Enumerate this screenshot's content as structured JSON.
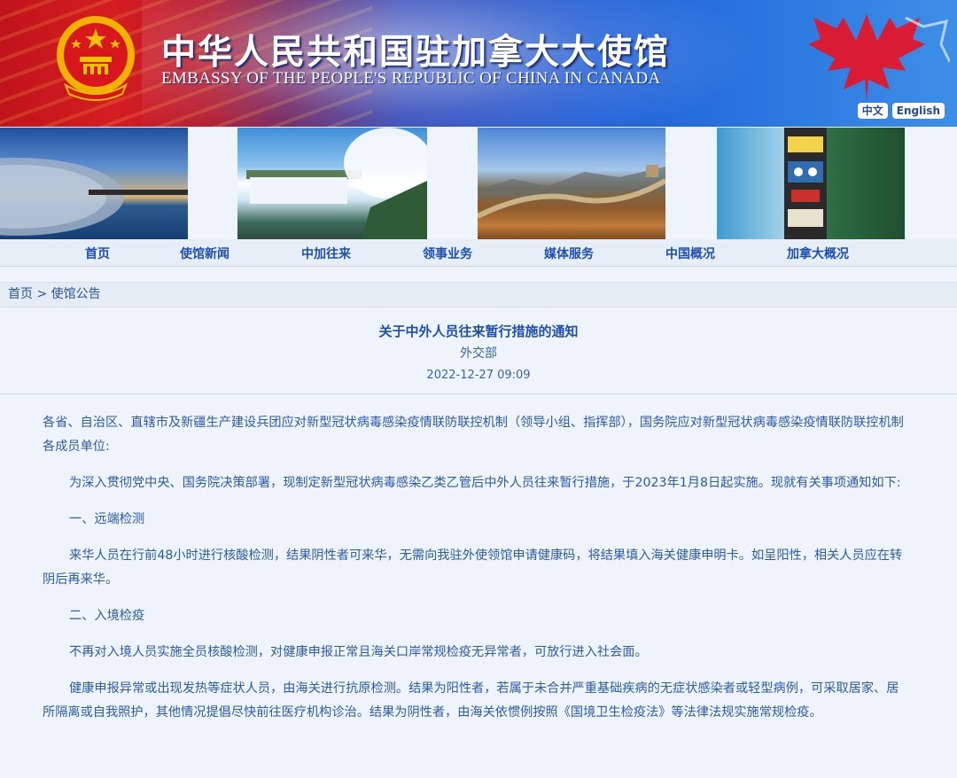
{
  "header": {
    "title_cn": "中华人民共和国驻加拿大大使馆",
    "title_en": "EMBASSY OF THE PEOPLE'S REPUBLIC OF CHINA IN CANADA",
    "lang_buttons": [
      "中文",
      "English"
    ],
    "colors": {
      "red": "#c0141a",
      "blue": "#1f5fd6",
      "gold": "#f5c200"
    }
  },
  "nav": [
    "首页",
    "使馆新闻",
    "中加往来",
    "领事业务",
    "媒体服务",
    "中国概况",
    "加拿大概况"
  ],
  "breadcrumb": {
    "home": "首页",
    "separator": ">",
    "section": "使馆公告"
  },
  "article": {
    "title": "关于中外人员往来暂行措施的通知",
    "source": "外交部",
    "date": "2022-12-27 09:09",
    "paragraphs": [
      "各省、自治区、直辖市及新疆生产建设兵团应对新型冠状病毒感染疫情联防联控机制（领导小组、指挥部），国务院应对新型冠状病毒感染疫情联防联控机制各成员单位:",
      "为深入贯彻党中央、国务院决策部署，现制定新型冠状病毒感染乙类乙管后中外人员往来暂行措施，于2023年1月8日起实施。现就有关事项通知如下:",
      "一、远端检测",
      "来华人员在行前48小时进行核酸检测，结果阴性者可来华，无需向我驻外使领馆申请健康码，将结果填入海关健康申明卡。如呈阳性，相关人员应在转阴后再来华。",
      "二、入境检疫",
      "不再对入境人员实施全员核酸检测，对健康申报正常且海关口岸常规检疫无异常者，可放行进入社会面。",
      "健康申报异常或出现发热等症状人员，由海关进行抗原检测。结果为阳性者，若属于未合并严重基础疾病的无症状感染者或轻型病例，可采取居家、居所隔离或自我照护，其他情况提倡尽快前往医疗机构诊治。结果为阴性者，由海关依惯例按照《国境卫生检疫法》等法律法规实施常规检疫。"
    ]
  }
}
